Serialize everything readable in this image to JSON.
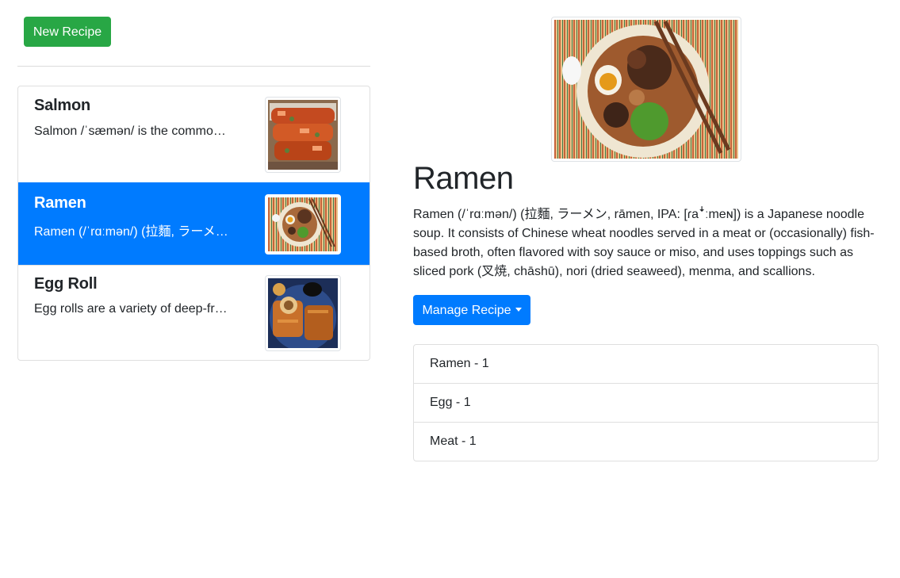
{
  "toolbar": {
    "new_recipe_label": "New Recipe"
  },
  "recipes": [
    {
      "name": "Salmon",
      "description": "Salmon /ˈsæmən/ is the common name for several species of ray-finned fish",
      "thumbnail_icon": "salmon-image",
      "active": false
    },
    {
      "name": "Ramen",
      "description": "Ramen (/ˈrɑːmən/) (拉麵, ラーメン, rāmen)",
      "thumbnail_icon": "ramen-image",
      "active": true
    },
    {
      "name": "Egg Roll",
      "description": "Egg rolls are a variety of deep-fried appetizers",
      "thumbnail_icon": "egg-roll-image",
      "active": false
    }
  ],
  "detail": {
    "title": "Ramen",
    "image_icon": "ramen-bowl-image",
    "description": "Ramen (/ˈrɑːmən/) (拉麵, ラーメン, rāmen, IPA: [ɾaꜜːmeɴ]) is a Japanese noodle soup. It consists of Chinese wheat noodles served in a meat or (occasionally) fish-based broth, often flavored with soy sauce or miso, and uses toppings such as sliced pork (叉焼, chāshū), nori (dried seaweed), menma, and scallions.",
    "manage_label": "Manage Recipe",
    "ingredients": [
      {
        "label": "Ramen - 1"
      },
      {
        "label": "Egg - 1"
      },
      {
        "label": "Meat - 1"
      }
    ]
  },
  "colors": {
    "success": "#28a745",
    "primary": "#007bff",
    "border": "#dfdfdf",
    "text": "#212529"
  }
}
